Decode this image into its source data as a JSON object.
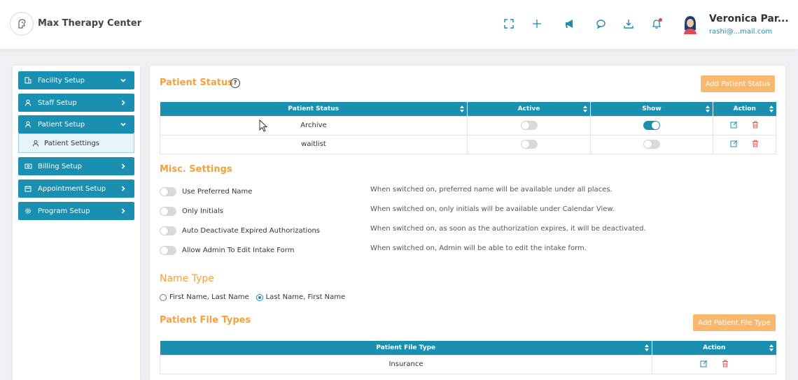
{
  "header": {
    "app_title": "Max Therapy Center",
    "user_name": "Veronica Par...",
    "user_email": "rashi@...mail.com",
    "icons": [
      "fullscreen-icon",
      "plus-icon",
      "megaphone-icon",
      "chat-icon",
      "download-icon",
      "bell-icon"
    ],
    "notification_dot_color": "#e0463c"
  },
  "sidebar": {
    "items": [
      {
        "label": "Facility Setup",
        "icon": "building-icon",
        "chevron": "down"
      },
      {
        "label": "Staff Setup",
        "icon": "person-icon",
        "chevron": "right"
      },
      {
        "label": "Patient Setup",
        "icon": "person-icon",
        "chevron": "down"
      },
      {
        "label": "Billing Setup",
        "icon": "bill-icon",
        "chevron": "right"
      },
      {
        "label": "Appointment Setup",
        "icon": "calendar-icon",
        "chevron": "right"
      },
      {
        "label": "Program Setup",
        "icon": "gear-icon",
        "chevron": "right"
      }
    ],
    "sub_item": {
      "label": "Patient Settings",
      "icon": "person-icon"
    }
  },
  "patient_status": {
    "title": "Patient Status",
    "add_button": "Add Patient Status",
    "columns": [
      "Patient Status",
      "Active",
      "Show",
      "Action"
    ],
    "rows": [
      {
        "status": "Archive",
        "active": false,
        "show": true
      },
      {
        "status": "waitlist",
        "active": false,
        "show": false
      }
    ]
  },
  "misc": {
    "title": "Misc. Settings",
    "settings": [
      {
        "label": "Use Preferred Name",
        "on": false,
        "description": "When switched on, preferred name will be available under all places."
      },
      {
        "label": "Only Initials",
        "on": false,
        "description": "When switched on, only initials will be available under Calendar View."
      },
      {
        "label": "Auto Deactivate Expired Authorizations",
        "on": false,
        "description": "When switched on, as soon as the authorization expires, it will be deactivated."
      },
      {
        "label": "Allow Admin To Edit Intake Form",
        "on": false,
        "description": "When switched on, Admin will be able to edit the intake form."
      }
    ]
  },
  "name_type": {
    "title": "Name Type",
    "options": [
      "First Name, Last Name",
      "Last Name, First Name"
    ],
    "selected": "Last Name, First Name"
  },
  "file_types": {
    "title": "Patient File Types",
    "add_button": "Add Patient File Type",
    "columns": [
      "Patient File Type",
      "Action"
    ],
    "rows": [
      {
        "type": "Insurance"
      }
    ]
  },
  "colors": {
    "accent": "#1a8fb0",
    "orange": "#f5a03a",
    "button_orange": "#f8b86d",
    "delete_red": "#e05a4e"
  }
}
